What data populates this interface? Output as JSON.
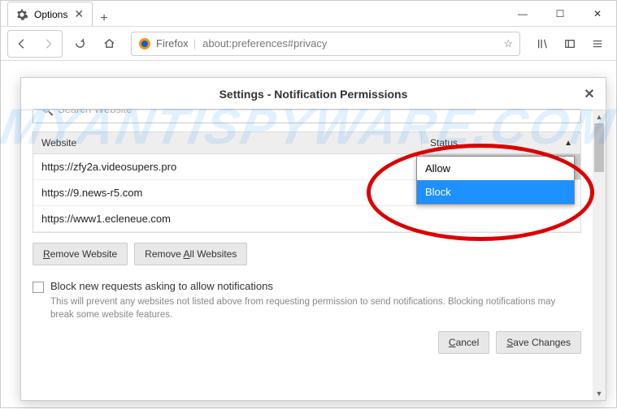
{
  "window": {
    "tab_title": "Options",
    "minimize": "—",
    "maximize": "☐",
    "close": "✕",
    "new_tab": "+"
  },
  "toolbar": {
    "identity_label": "Firefox",
    "url": "about:preferences#privacy"
  },
  "modal": {
    "title": "Settings - Notification Permissions",
    "search_placeholder": "Search Website",
    "table": {
      "header_website": "Website",
      "header_status": "Status",
      "rows": [
        {
          "website": "https://zfy2a.videosupers.pro",
          "status": "Block"
        },
        {
          "website": "https://9.news-r5.com",
          "status": ""
        },
        {
          "website": "https://www1.ecleneue.com",
          "status": ""
        }
      ]
    },
    "dropdown": {
      "options": [
        "Allow",
        "Block"
      ],
      "highlighted": "Block"
    },
    "buttons": {
      "remove_website": "Remove Website",
      "remove_all": "Remove All Websites",
      "cancel": "Cancel",
      "save": "Save Changes"
    },
    "checkbox": {
      "label": "Block new requests asking to allow notifications",
      "description": "This will prevent any websites not listed above from requesting permission to send notifications. Blocking notifications may break some website features."
    }
  },
  "watermark": "MYANTISPYWARE.COM"
}
